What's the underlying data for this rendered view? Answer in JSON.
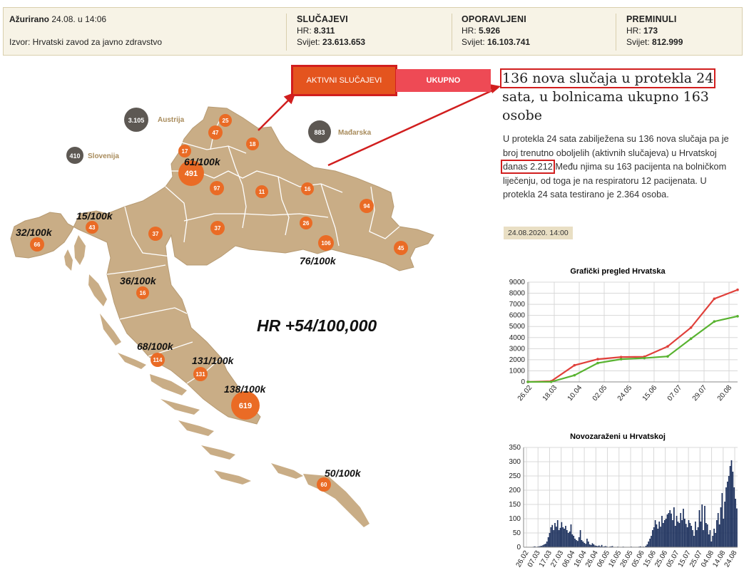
{
  "stats": {
    "updated_label": "Ažurirano",
    "updated_value": "24.08. u 14:06",
    "source": "Izvor: Hrvatski zavod za javno zdravstvo",
    "cases": {
      "title": "SLUČAJEVI",
      "hr_label": "HR:",
      "hr": "8.311",
      "world_label": "Svijet:",
      "world": "23.613.653"
    },
    "recovered": {
      "title": "OPORAVLJENI",
      "hr_label": "HR:",
      "hr": "5.926",
      "world_label": "Svijet:",
      "world": "16.103.741"
    },
    "deceased": {
      "title": "PREMINULI",
      "hr_label": "HR:",
      "hr": "173",
      "world_label": "Svijet:",
      "world": "812.999"
    }
  },
  "toggle": {
    "active_label": "AKTIVNI SLUČAJEVI",
    "total_label": "UKUPNO"
  },
  "article": {
    "headline_boxed": "136 nova slučaja u protekla 24",
    "headline_rest": "sata, u bolnicama ukupno 163 osobe",
    "body_before": "U protekla 24 sata zabilježena su 136 nova slučaja pa je broj trenutno oboljelih (aktivnih slučajeva) u Hrvatskoj",
    "body_boxed": "danas 2.212",
    "body_after": "Među njima su 163 pacijenta na bolničkom liječenju, od toga je na respiratoru 12 pacijenata. U protekla 24 sata testirano je 2.364 osoba.",
    "date": "24.08.2020. 14:00"
  },
  "map": {
    "headline": "HR +54/100,000",
    "neighbours": [
      {
        "name": "Austrija",
        "count": "3.105"
      },
      {
        "name": "Mađarska",
        "count": "883"
      },
      {
        "name": "Slovenija",
        "count": "410"
      }
    ],
    "county_counts": [
      "25",
      "47",
      "18",
      "17",
      "491",
      "97",
      "11",
      "16",
      "94",
      "43",
      "66",
      "37",
      "37",
      "26",
      "106",
      "45",
      "16",
      "114",
      "131",
      "619",
      "60"
    ],
    "rate_labels": [
      "61/100k",
      "15/100k",
      "32/100k",
      "76/100k",
      "36/100k",
      "68/100k",
      "131/100k",
      "138/100k",
      "50/100k"
    ],
    "colors": {
      "land": "#c9ad86",
      "border": "#ffffff",
      "bubble": "#ea6b25",
      "neighbour_bubble": "#5d5853",
      "annotation": "#d11e1e"
    }
  },
  "chart_data": [
    {
      "type": "line",
      "title": "Grafički pregled Hrvatska",
      "x": [
        "26.02",
        "18.03",
        "10.04",
        "02.05",
        "24.05",
        "15.06",
        "07.07",
        "29.07",
        "20.08",
        "24.08"
      ],
      "ylim": [
        0,
        9000
      ],
      "yticks": [
        0,
        1000,
        2000,
        3000,
        4000,
        5000,
        6000,
        7000,
        8000,
        9000
      ],
      "xticks": [
        "26.02",
        "18.03",
        "10.04",
        "02.05",
        "24.05",
        "15.06",
        "07.07",
        "29.07",
        "20.08"
      ],
      "grid": true,
      "series": [
        {
          "color": "#e0403b",
          "values": [
            0,
            60,
            1500,
            2050,
            2240,
            2270,
            3200,
            4900,
            7500,
            8311
          ]
        },
        {
          "color": "#58b330",
          "values": [
            0,
            5,
            600,
            1700,
            2050,
            2150,
            2300,
            3900,
            5450,
            5926
          ]
        }
      ]
    },
    {
      "type": "bar",
      "title": "Novozaraženi u Hrvatskoj",
      "ylim": [
        0,
        350
      ],
      "yticks": [
        0,
        50,
        100,
        150,
        200,
        250,
        300,
        350
      ],
      "xticks": [
        "26.02",
        "07.03",
        "17.03",
        "27.03",
        "06.04",
        "16.04",
        "26.04",
        "06.05",
        "16.05",
        "26.05",
        "05.06",
        "15.06",
        "25.06",
        "05.07",
        "15.07",
        "25.07",
        "04.08",
        "14.08",
        "24.08"
      ],
      "color": "#1b2f5c",
      "values": [
        0,
        0,
        0,
        1,
        0,
        1,
        0,
        2,
        3,
        1,
        2,
        3,
        4,
        5,
        7,
        10,
        12,
        20,
        35,
        50,
        70,
        78,
        60,
        85,
        72,
        95,
        60,
        68,
        88,
        70,
        65,
        75,
        60,
        50,
        55,
        80,
        45,
        40,
        30,
        25,
        22,
        35,
        60,
        25,
        20,
        15,
        12,
        30,
        20,
        10,
        8,
        14,
        10,
        6,
        5,
        4,
        6,
        3,
        8,
        2,
        3,
        4,
        2,
        1,
        2,
        3,
        4,
        1,
        0,
        1,
        2,
        1,
        0,
        1,
        2,
        1,
        0,
        1,
        0,
        1,
        2,
        1,
        0,
        1,
        0,
        1,
        2,
        3,
        1,
        2,
        1,
        5,
        10,
        20,
        30,
        40,
        60,
        70,
        95,
        80,
        65,
        90,
        72,
        110,
        85,
        95,
        100,
        115,
        120,
        130,
        118,
        95,
        140,
        75,
        110,
        90,
        85,
        120,
        95,
        135,
        100,
        82,
        70,
        95,
        85,
        75,
        60,
        40,
        90,
        60,
        70,
        130,
        90,
        150,
        60,
        145,
        85,
        80,
        45,
        60,
        20,
        40,
        65,
        50,
        95,
        120,
        80,
        140,
        190,
        100,
        160,
        210,
        230,
        250,
        285,
        305,
        265,
        210,
        170,
        136
      ]
    }
  ]
}
